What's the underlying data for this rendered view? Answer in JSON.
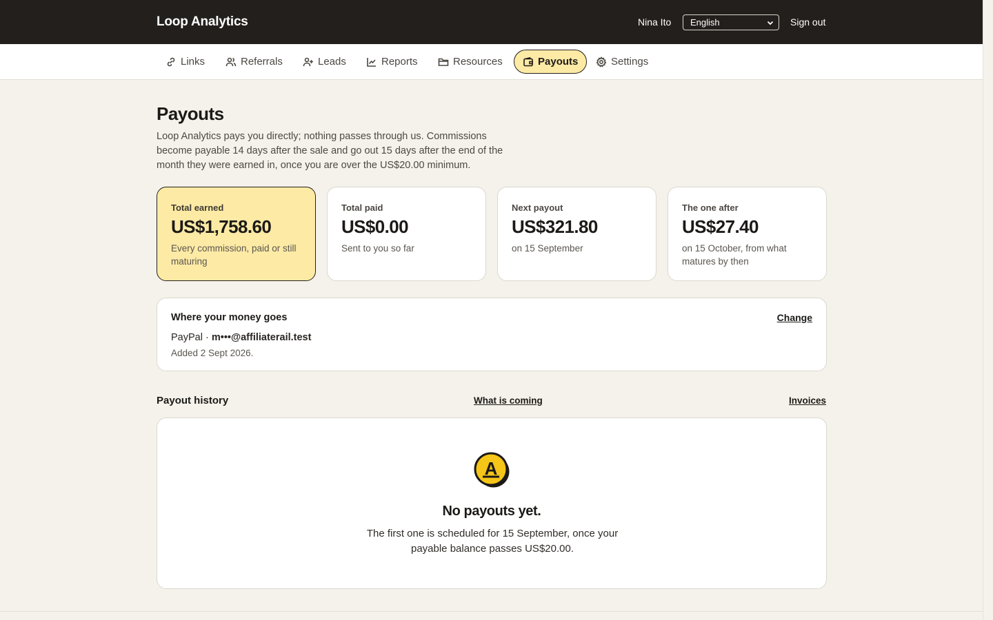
{
  "header": {
    "brand": "Loop Analytics",
    "user_name": "Nina Ito",
    "language": "English",
    "sign_out": "Sign out"
  },
  "nav": {
    "tabs": [
      {
        "label": "Links",
        "icon": "link-icon"
      },
      {
        "label": "Referrals",
        "icon": "users-icon"
      },
      {
        "label": "Leads",
        "icon": "user-plus-icon"
      },
      {
        "label": "Reports",
        "icon": "line-chart-icon"
      },
      {
        "label": "Resources",
        "icon": "folder-icon"
      },
      {
        "label": "Payouts",
        "icon": "wallet-icon",
        "active": true
      },
      {
        "label": "Settings",
        "icon": "gear-icon"
      }
    ]
  },
  "page": {
    "title": "Payouts",
    "description": "Loop Analytics pays you directly; nothing passes through us. Commissions become payable 14 days after the sale and go out 15 days after the end of the month they were earned in, once you are over the US$20.00 minimum."
  },
  "stats": [
    {
      "label": "Total earned",
      "value": "US$1,758.60",
      "sub": "Every commission, paid or still maturing"
    },
    {
      "label": "Total paid",
      "value": "US$0.00",
      "sub": "Sent to you so far"
    },
    {
      "label": "Next payout",
      "value": "US$321.80",
      "sub": "on 15 September"
    },
    {
      "label": "The one after",
      "value": "US$27.40",
      "sub": "on 15 October, from what matures by then"
    }
  ],
  "payout_method": {
    "title": "Where your money goes",
    "change": "Change",
    "provider": "PayPal · ",
    "account": "m•••@affiliaterail.test",
    "added": "Added 2 Sept 2026."
  },
  "history": {
    "title": "Payout history",
    "what_is_coming": "What is coming",
    "invoices": "Invoices",
    "empty_title": "No payouts yet.",
    "empty_desc": "The first one is scheduled for 15 September, once your payable balance passes US$20.00.",
    "empty_icon_letter": "A"
  },
  "colors": {
    "header_bg": "#231f1c",
    "accent": "#fdeaa5",
    "accent_icon": "#f5c518",
    "page_bg": "#f4f2ea"
  }
}
